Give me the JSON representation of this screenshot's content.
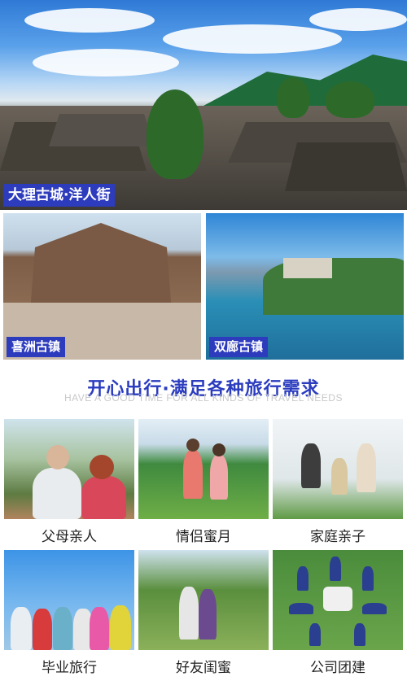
{
  "hero": {
    "tag": "大理古城·洋人街"
  },
  "photos": [
    {
      "tag": "喜洲古镇"
    },
    {
      "tag": "双廊古镇"
    }
  ],
  "slogan": {
    "main": "开心出行·满足各种旅行需求",
    "en": "HAVE A GOOD TIME FOR ALL KINDS OF TRAVEL NEEDS"
  },
  "grid": [
    {
      "label": "父母亲人"
    },
    {
      "label": "情侣蜜月"
    },
    {
      "label": "家庭亲子"
    },
    {
      "label": "毕业旅行"
    },
    {
      "label": "好友闺蜜"
    },
    {
      "label": "公司团建"
    }
  ],
  "colors": {
    "tag_bg": "#2d3bbd",
    "slogan": "#2b3cbf",
    "slogan_en": "#c8c8c8"
  }
}
